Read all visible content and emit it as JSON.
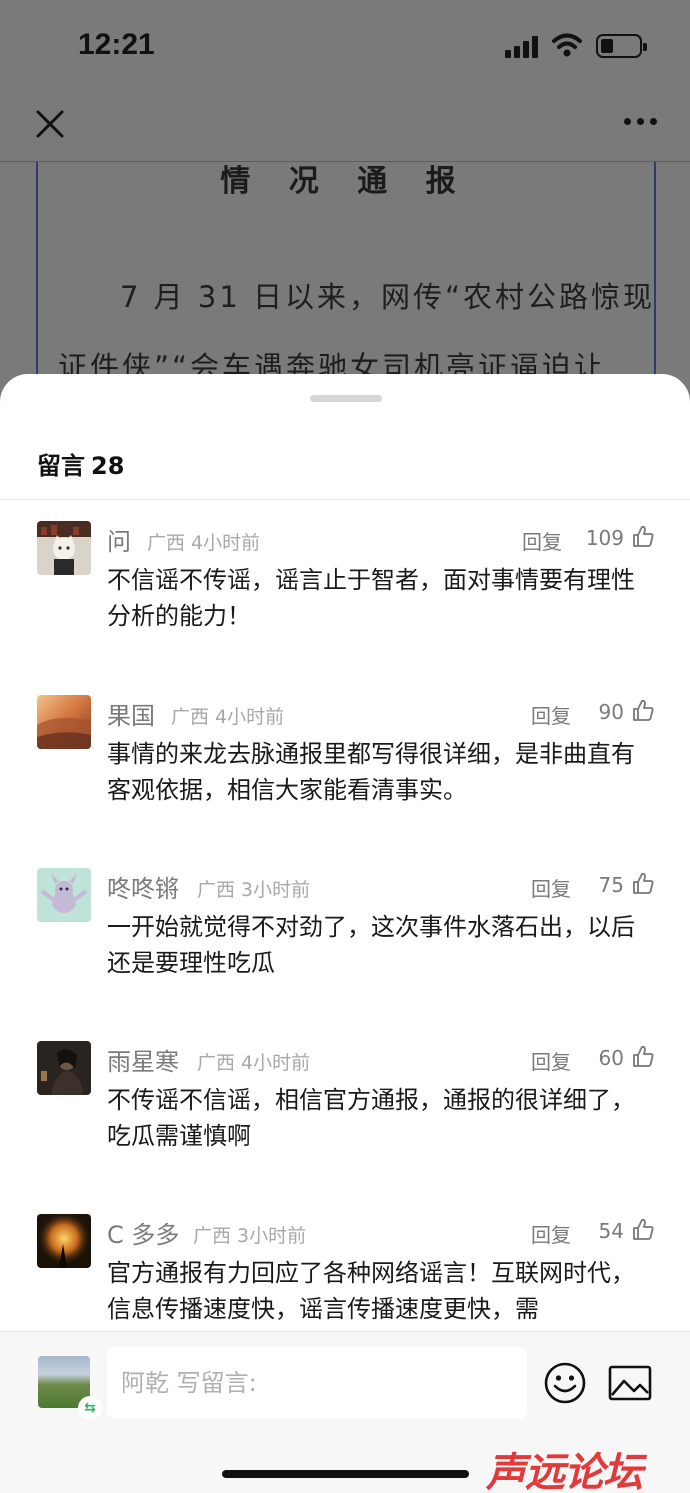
{
  "status_bar": {
    "time": "12:21"
  },
  "article": {
    "title": "情 况 通 报",
    "line1": "7 月 31 日以来，网传“农村公路惊现",
    "line2": "证件侠”“会车遇奔驰女司机亮证逼迫让"
  },
  "sheet": {
    "title": "留言",
    "count": "28",
    "comments": [
      {
        "name": "问",
        "meta": "广西 4小时前",
        "reply": "回复",
        "likes": "109",
        "text": "不信谣不传谣，谣言止于智者，面对事情要有理性分析的能力！"
      },
      {
        "name": "果国",
        "meta": "广西 4小时前",
        "reply": "回复",
        "likes": "90",
        "text": "事情的来龙去脉通报里都写得很详细，是非曲直有客观依据，相信大家能看清事实。"
      },
      {
        "name": "咚咚锵",
        "meta": "广西 3小时前",
        "reply": "回复",
        "likes": "75",
        "text": "一开始就觉得不对劲了，这次事件水落石出，以后还是要理性吃瓜"
      },
      {
        "name": "雨星寒",
        "meta": "广西 4小时前",
        "reply": "回复",
        "likes": "60",
        "text": "不传谣不信谣，相信官方通报，通报的很详细了，吃瓜需谨慎啊"
      },
      {
        "name": "C 多多",
        "meta": "广西 3小时前",
        "reply": "回复",
        "likes": "54",
        "text": "官方通报有力回应了各种网络谣言！互联网时代，信息传播速度快，谣言传播速度更快，需"
      }
    ]
  },
  "input_bar": {
    "placeholder": "阿乾  写留言:"
  },
  "watermark": "声远论坛",
  "colors": {
    "sheet_bg": "#ffffff",
    "overlay": "#7a7a7a",
    "meta_gray": "#a8a8a8",
    "watermark_red": "#e23a3a"
  }
}
